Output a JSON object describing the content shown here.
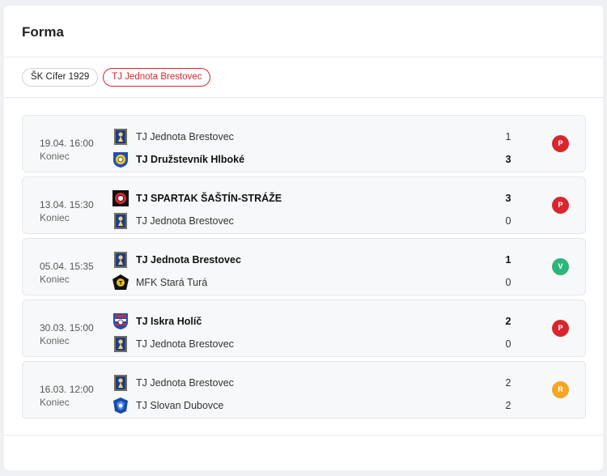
{
  "title": "Forma",
  "tabs": [
    {
      "label": "ŠK Cífer 1929",
      "active": false
    },
    {
      "label": "TJ Jednota Brestovec",
      "active": true
    }
  ],
  "colors": {
    "accent": "#d9262e",
    "loss": "#d9262e",
    "win": "#2fb47c",
    "draw": "#f5a623"
  },
  "matches": [
    {
      "date": "19.04. 16:00",
      "status": "Koniec",
      "home": {
        "name": "TJ Jednota Brestovec",
        "score": "1",
        "winner": false,
        "logo": "brestovec-crest-icon"
      },
      "away": {
        "name": "TJ Družstevník Hlboké",
        "score": "3",
        "winner": true,
        "logo": "hlboke-crest-icon"
      },
      "result": "P",
      "result_type": "loss"
    },
    {
      "date": "13.04. 15:30",
      "status": "Koniec",
      "home": {
        "name": "TJ SPARTAK ŠAŠTÍN-STRÁŽE",
        "score": "3",
        "winner": true,
        "logo": "sastin-crest-icon"
      },
      "away": {
        "name": "TJ Jednota Brestovec",
        "score": "0",
        "winner": false,
        "logo": "brestovec-crest-icon"
      },
      "result": "P",
      "result_type": "loss"
    },
    {
      "date": "05.04. 15:35",
      "status": "Koniec",
      "home": {
        "name": "TJ Jednota Brestovec",
        "score": "1",
        "winner": true,
        "logo": "brestovec-crest-icon"
      },
      "away": {
        "name": "MFK Stará Turá",
        "score": "0",
        "winner": false,
        "logo": "stara-tura-crest-icon"
      },
      "result": "V",
      "result_type": "win"
    },
    {
      "date": "30.03. 15:00",
      "status": "Koniec",
      "home": {
        "name": "TJ Iskra Holíč",
        "score": "2",
        "winner": true,
        "logo": "holic-crest-icon"
      },
      "away": {
        "name": "TJ Jednota Brestovec",
        "score": "0",
        "winner": false,
        "logo": "brestovec-crest-icon"
      },
      "result": "P",
      "result_type": "loss"
    },
    {
      "date": "16.03. 12:00",
      "status": "Koniec",
      "home": {
        "name": "TJ Jednota Brestovec",
        "score": "2",
        "winner": false,
        "logo": "brestovec-crest-icon"
      },
      "away": {
        "name": "TJ Slovan Dubovce",
        "score": "2",
        "winner": false,
        "logo": "dubovce-crest-icon"
      },
      "result": "R",
      "result_type": "draw"
    }
  ]
}
